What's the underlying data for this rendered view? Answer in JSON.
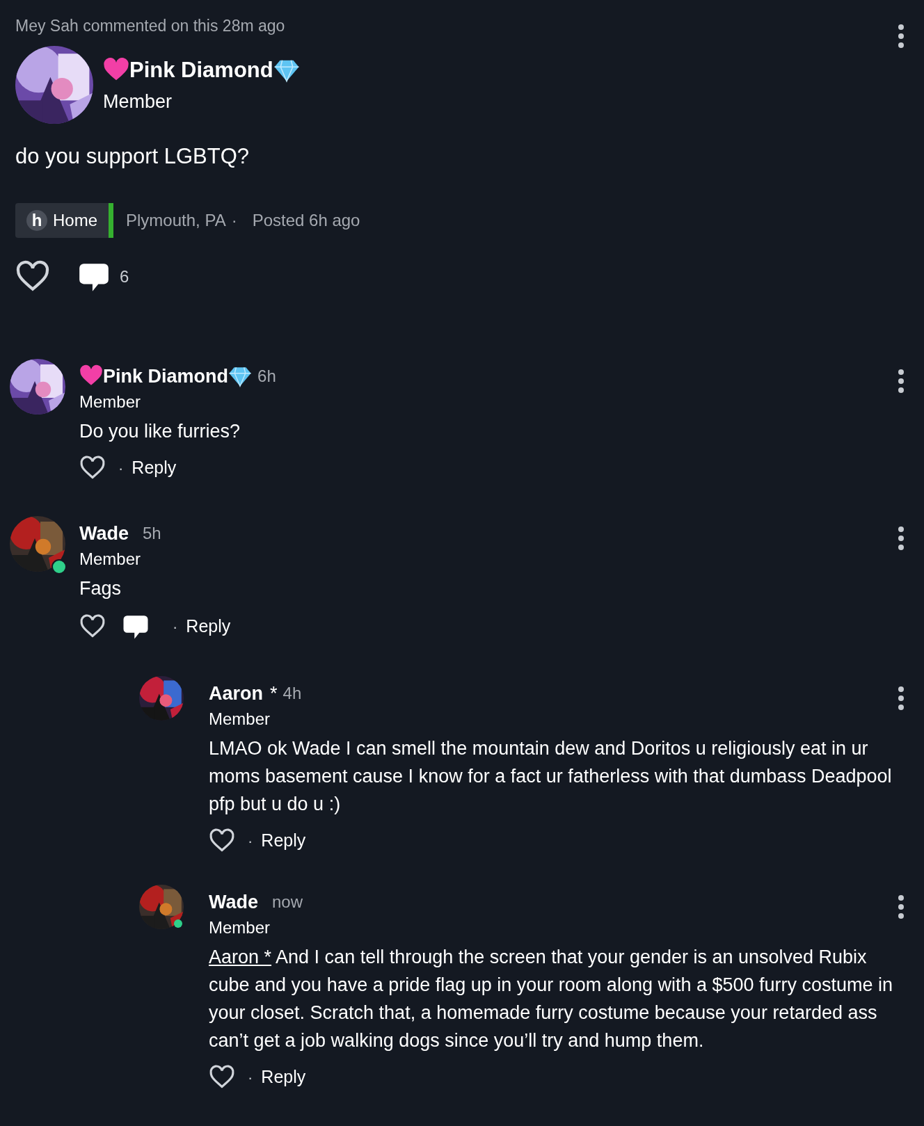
{
  "activity": "Mey Sah commented on this 28m ago",
  "post": {
    "author": "Pink Diamond",
    "role": "Member",
    "text": "do you support LGBTQ?",
    "group": {
      "letter": "h",
      "label": "Home"
    },
    "location": "Plymouth, PA",
    "separator": "·",
    "posted": "Posted 6h ago",
    "comment_count": "6"
  },
  "comments": [
    {
      "author": "Pink Diamond",
      "emoji_name": true,
      "time": "6h",
      "role": "Member",
      "text": "Do you like furries?",
      "online": false,
      "has_thread_icon": false,
      "separator": "·",
      "reply": "Reply",
      "nested": false
    },
    {
      "author": "Wade",
      "emoji_name": false,
      "time": "5h",
      "role": "Member",
      "text": "Fags",
      "online": true,
      "has_thread_icon": true,
      "separator": "·",
      "reply": "Reply",
      "nested": false
    },
    {
      "author": "Aaron",
      "flair": "*",
      "emoji_name": false,
      "time": "4h",
      "role": "Member",
      "text": "LMAO ok Wade I can smell the mountain dew and Doritos u religiously eat in ur moms basement cause I know for a fact ur fatherless with that dumbass Deadpool pfp but u do u :)",
      "online": false,
      "has_thread_icon": false,
      "separator": "·",
      "reply": "Reply",
      "nested": true
    },
    {
      "author": "Wade",
      "emoji_name": false,
      "time": "now",
      "role": "Member",
      "mention": "Aaron *",
      "text": "And I can tell through the screen that your gender is an unsolved Rubix cube and you have a pride flag up in your room along with a $500 furry costume in your closet. Scratch that, a homemade furry costume because your retarded ass can’t get a job walking dogs since you’ll try and hump them.",
      "online": true,
      "has_thread_icon": false,
      "separator": "·",
      "reply": "Reply",
      "nested": true
    }
  ]
}
